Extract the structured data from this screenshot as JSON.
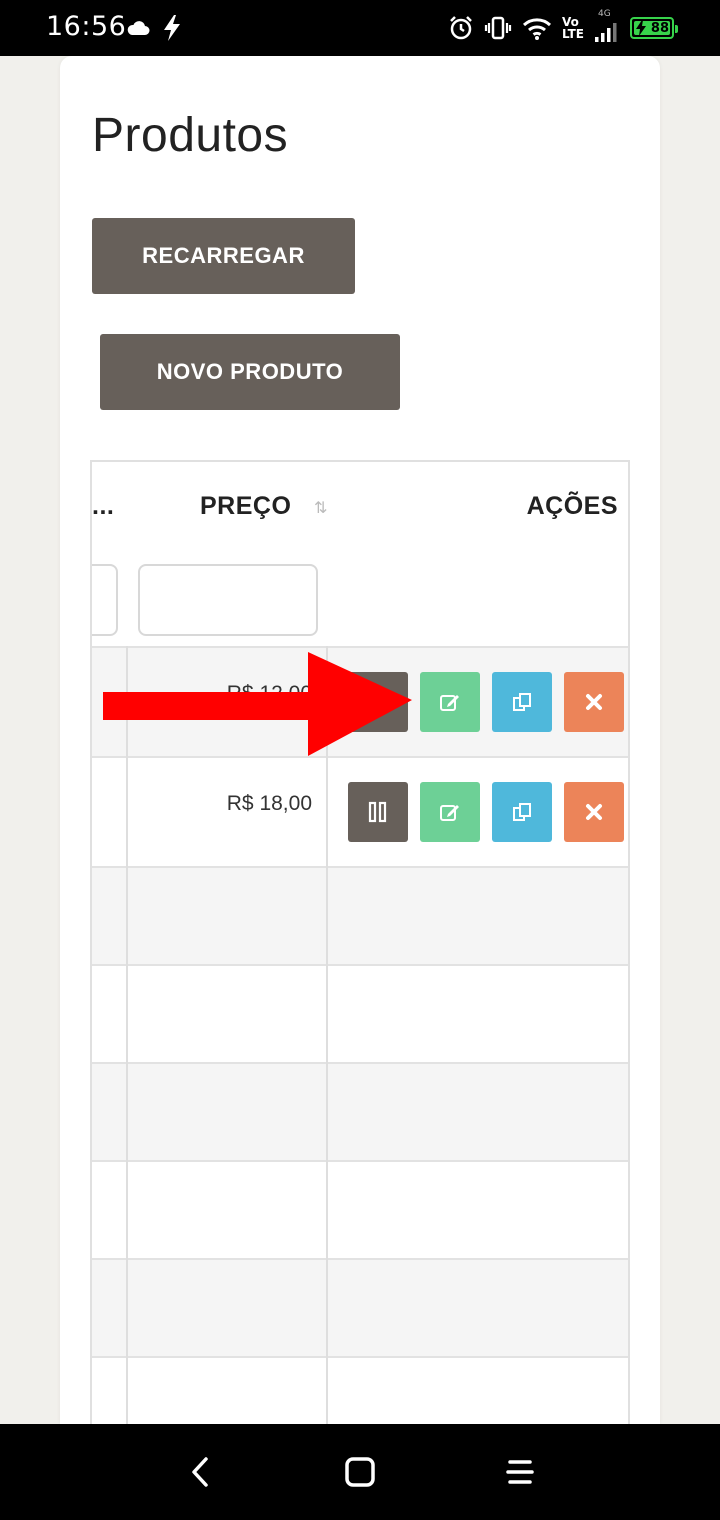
{
  "status_bar": {
    "time": "16:56",
    "network_top": "Vo",
    "network_bottom": "LTE",
    "network_type": "4G",
    "battery": "88",
    "icons": [
      "cloud-icon",
      "bolt-icon",
      "alarm-icon",
      "vibrate-icon",
      "wifi-icon",
      "signal-icon",
      "battery-icon"
    ]
  },
  "page": {
    "title": "Produtos",
    "reload_label": "RECARREGAR",
    "new_product_label": "NOVO PRODUTO"
  },
  "table": {
    "columns": {
      "truncated": "...",
      "price": "PREÇO",
      "actions": "AÇÕES"
    },
    "rows": [
      {
        "price": "R$ 12,00"
      },
      {
        "price": "R$ 18,00"
      }
    ],
    "action_icons": [
      "pause-icon",
      "edit-icon",
      "copy-icon",
      "delete-icon"
    ]
  },
  "colors": {
    "button_dark": "#67605a",
    "edit": "#6dd096",
    "copy": "#4fb8db",
    "delete": "#ec8459",
    "arrow": "#ff0000",
    "battery": "#37d34b"
  },
  "nav_bar": {
    "icons": [
      "back-icon",
      "home-icon",
      "menu-icon"
    ]
  }
}
